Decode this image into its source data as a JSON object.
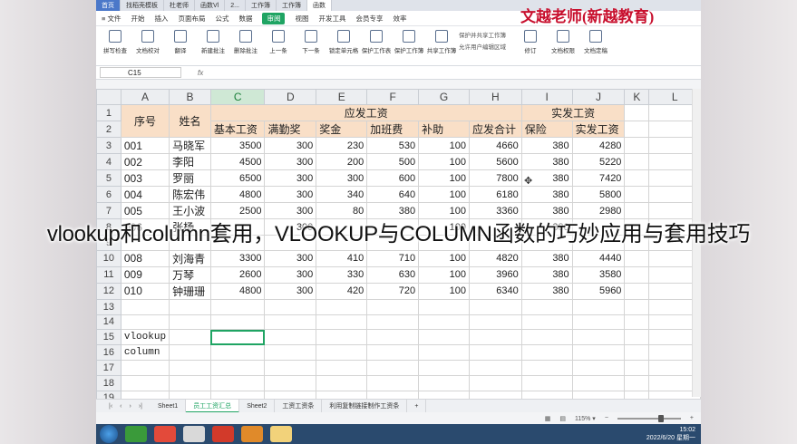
{
  "window": {
    "home_tab": "首页",
    "doc_tabs": [
      "找稻壳模板",
      "杜老师",
      "函数Vl",
      "2...",
      "工作簿",
      "工作簿",
      "函数"
    ],
    "watermark": "文越老师(新越教育)"
  },
  "menu": {
    "file": "≡ 文件",
    "items": [
      "开始",
      "插入",
      "页面布局",
      "公式",
      "数据",
      "审阅",
      "视图",
      "开发工具",
      "会员专享",
      "效率"
    ],
    "active": "审阅"
  },
  "ribbon": {
    "buttons": [
      "拼写检查",
      "文档校对",
      "翻译",
      "新建批注",
      "删除批注",
      "上一条",
      "下一条",
      "锁定单元格",
      "保护工作表",
      "保护工作簿",
      "共享工作簿",
      "修订",
      "文档权限",
      "文档定稿"
    ],
    "group_right": [
      "保护并共享工作簿",
      "允许用户编辑区域"
    ]
  },
  "formula_bar": {
    "name_box": "C15",
    "fx": "fx"
  },
  "columns": [
    "A",
    "B",
    "C",
    "D",
    "E",
    "F",
    "G",
    "H",
    "I",
    "J",
    "K",
    "L"
  ],
  "selected_column": "C",
  "header": {
    "seq": "序号",
    "name": "姓名",
    "group1": "应发工资",
    "group2": "实发工资",
    "sub": [
      "基本工资",
      "满勤奖",
      "奖金",
      "加班费",
      "补助",
      "应发合计",
      "保险",
      "实发工资"
    ]
  },
  "rows": [
    {
      "r": "3",
      "id": "001",
      "name": "马晓军",
      "v": [
        "3500",
        "300",
        "230",
        "530",
        "100",
        "4660",
        "380",
        "4280"
      ]
    },
    {
      "r": "4",
      "id": "002",
      "name": "李阳",
      "v": [
        "4500",
        "300",
        "200",
        "500",
        "100",
        "5600",
        "380",
        "5220"
      ]
    },
    {
      "r": "5",
      "id": "003",
      "name": "罗丽",
      "v": [
        "6500",
        "300",
        "300",
        "600",
        "100",
        "7800",
        "380",
        "7420"
      ]
    },
    {
      "r": "6",
      "id": "004",
      "name": "陈宏伟",
      "v": [
        "4800",
        "300",
        "340",
        "640",
        "100",
        "6180",
        "380",
        "5800"
      ]
    },
    {
      "r": "7",
      "id": "005",
      "name": "王小波",
      "v": [
        "2500",
        "300",
        "80",
        "380",
        "100",
        "3360",
        "380",
        "2980"
      ]
    },
    {
      "r": "8",
      "id": "006",
      "name": "张杨",
      "v": [
        "",
        "300",
        "",
        "",
        "100",
        "",
        "380",
        ""
      ]
    },
    {
      "r": "9",
      "id": "",
      "name": "",
      "v": [
        "",
        "",
        "",
        "",
        "",
        "",
        "",
        ""
      ]
    },
    {
      "r": "10",
      "id": "008",
      "name": "刘海青",
      "v": [
        "3300",
        "300",
        "410",
        "710",
        "100",
        "4820",
        "380",
        "4440"
      ]
    },
    {
      "r": "11",
      "id": "009",
      "name": "万琴",
      "v": [
        "2600",
        "300",
        "330",
        "630",
        "100",
        "3960",
        "380",
        "3580"
      ]
    },
    {
      "r": "12",
      "id": "010",
      "name": "钟珊珊",
      "v": [
        "4800",
        "300",
        "420",
        "720",
        "100",
        "6340",
        "380",
        "5960"
      ]
    }
  ],
  "extra_rows": [
    "13",
    "14",
    "15",
    "16",
    "17",
    "18",
    "19",
    "20"
  ],
  "notes": {
    "r15": "vlookup",
    "r16": "column"
  },
  "sheet_tabs": [
    "Sheet1",
    "员工工资汇总",
    "Sheet2",
    "工资工资条",
    "利用复制链接制作工资条"
  ],
  "active_sheet": "员工工资汇总",
  "status": {
    "zoom": "115% ▾"
  },
  "taskbar": {
    "time": "15:02",
    "date": "2022/6/20 星期一"
  },
  "caption": "vlookup和column套用，VLOOKUP与COLUMN函数的巧妙应用与套用技巧"
}
